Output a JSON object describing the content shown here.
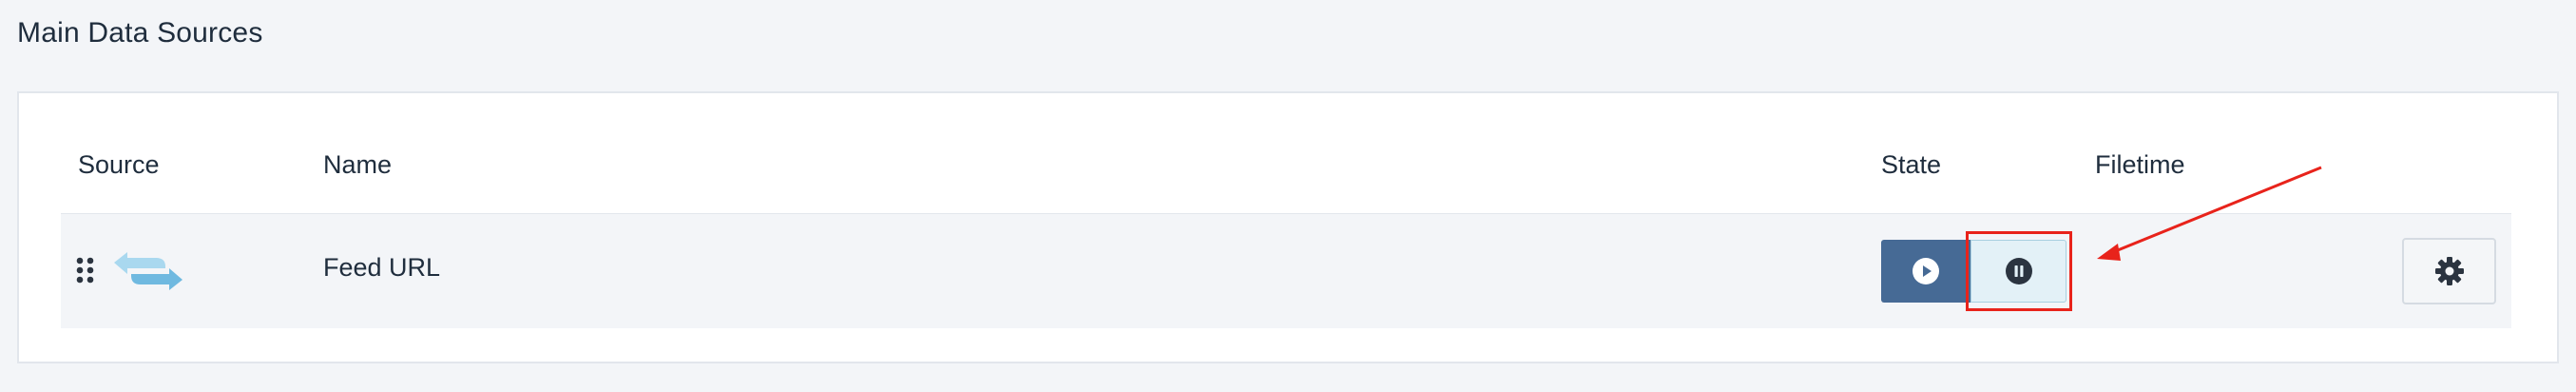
{
  "section": {
    "title": "Main Data Sources"
  },
  "table": {
    "columns": {
      "source": "Source",
      "name": "Name",
      "state": "State",
      "filetime": "Filetime"
    },
    "rows": [
      {
        "source_icon": "exchange-arrows-icon",
        "name": "Feed URL",
        "state": "paused",
        "filetime": ""
      }
    ]
  },
  "icons": {
    "drag": "drag-handle-icon",
    "play": "play-icon",
    "pause": "pause-icon",
    "settings": "gear-icon"
  },
  "colors": {
    "play_button": "#466a95",
    "pause_button_active": "#e3f1f7",
    "annotation": "#e8231b",
    "source_icon": "#7fc3e6"
  }
}
